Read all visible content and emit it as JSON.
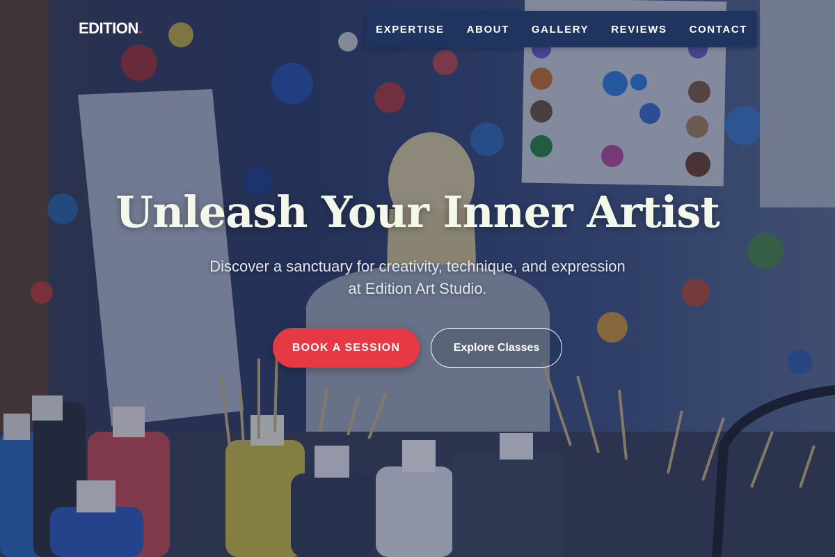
{
  "brand": {
    "name": "EDITION",
    "dot": ".",
    "dot_color": "#e63946"
  },
  "nav": {
    "items": [
      {
        "label": "EXPERTISE"
      },
      {
        "label": "ABOUT"
      },
      {
        "label": "GALLERY"
      },
      {
        "label": "REVIEWS"
      },
      {
        "label": "CONTACT"
      }
    ],
    "background": "#1f3560"
  },
  "hero": {
    "title": "Unleash Your Inner Artist",
    "subtitle": "Discover a sanctuary for creativity, technique, and expression at Edition Art Studio.",
    "background_image": "art-studio-painting-scene",
    "primary_cta": "BOOK A SESSION",
    "secondary_cta": "Explore Classes"
  },
  "colors": {
    "accent": "#e63946",
    "title": "#f4f8ea",
    "overlay": "#142040"
  }
}
